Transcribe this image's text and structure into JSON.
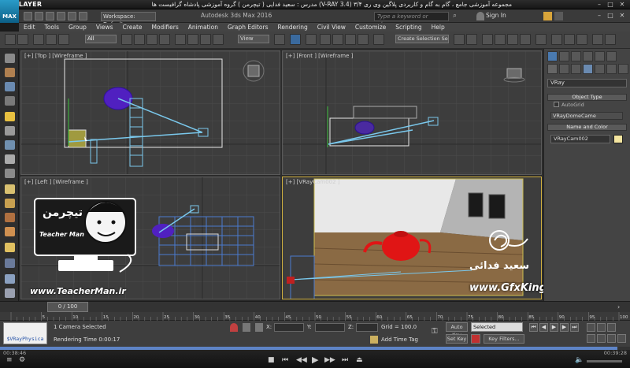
{
  "player": {
    "logo": "KMPLAYER",
    "title": "مجموعه آموزشی جامع ، گام به گام و کاربردی پلاگین وی ری ۳/۴ (V-RAY 3.4) مدرس : سعید فدایی ( تیچرمن ) گروه آموزشی پادشاه گرافیست ها",
    "elapsed": "00:38:46",
    "total": "00:39:28",
    "progress": 0.98
  },
  "max": {
    "logo": "MAX",
    "workspace": "Workspace: Default",
    "app_title": "Autodesk 3ds Max 2016",
    "search_placeholder": "Type a keyword or phrase",
    "sign_in": "Sign In"
  },
  "menu": [
    "Edit",
    "Tools",
    "Group",
    "Views",
    "Create",
    "Modifiers",
    "Animation",
    "Graph Editors",
    "Rendering",
    "Civil View",
    "Customize",
    "Scripting",
    "Help"
  ],
  "toolbar": {
    "selection_filter": "All",
    "ref_coord": "View",
    "selection_set": "Create Selection Se"
  },
  "viewports": {
    "top": "[+] [Top ] [Wireframe ]",
    "front": "[+] [Front ] [Wireframe ]",
    "left": "[+] [Left ] [Wireframe ]",
    "camera": "[+] [VRayCam002 ]"
  },
  "command_panel": {
    "renderer": "VRay",
    "object_type": "Object Type",
    "autogrid": "AutoGrid",
    "dome_camera": "VRayDomeCame",
    "name_and_color": "Name and Color",
    "object_name": "VRayCam002"
  },
  "timeline": {
    "frame_counter": "0 / 100",
    "ticks": [
      "5",
      "10",
      "15",
      "20",
      "25",
      "30",
      "35",
      "40",
      "45",
      "50",
      "55",
      "60",
      "65",
      "70",
      "75",
      "80",
      "85",
      "90",
      "95",
      "100"
    ]
  },
  "status": {
    "script_listener": "$VRayPhysica",
    "selection": "1 Camera Selected",
    "rendering_time_label": "Rendering Time  0:00:17",
    "x_label": "X:",
    "y_label": "Y:",
    "z_label": "Z:",
    "grid": "Grid = 100.0",
    "add_time_tag": "Add Time Tag",
    "auto_key": "Auto Key",
    "set_key": "Set Key",
    "key_mode": "Selected",
    "key_filters": "Key Filters..."
  },
  "watermarks": {
    "teacherman_url": "www.TeacherMan.ir",
    "teacherman_name": "Teacher Man",
    "teacherman_fa": "تیچرمن",
    "gfxking_url": "www.GfxKing.ir",
    "instructor_fa": "سعید فدائی"
  },
  "colors": {
    "accent": "#5e84c6",
    "teapot": "#e01515",
    "viewport_bg": "#3d3d3d",
    "camera_wire": "#6fc3e8"
  }
}
